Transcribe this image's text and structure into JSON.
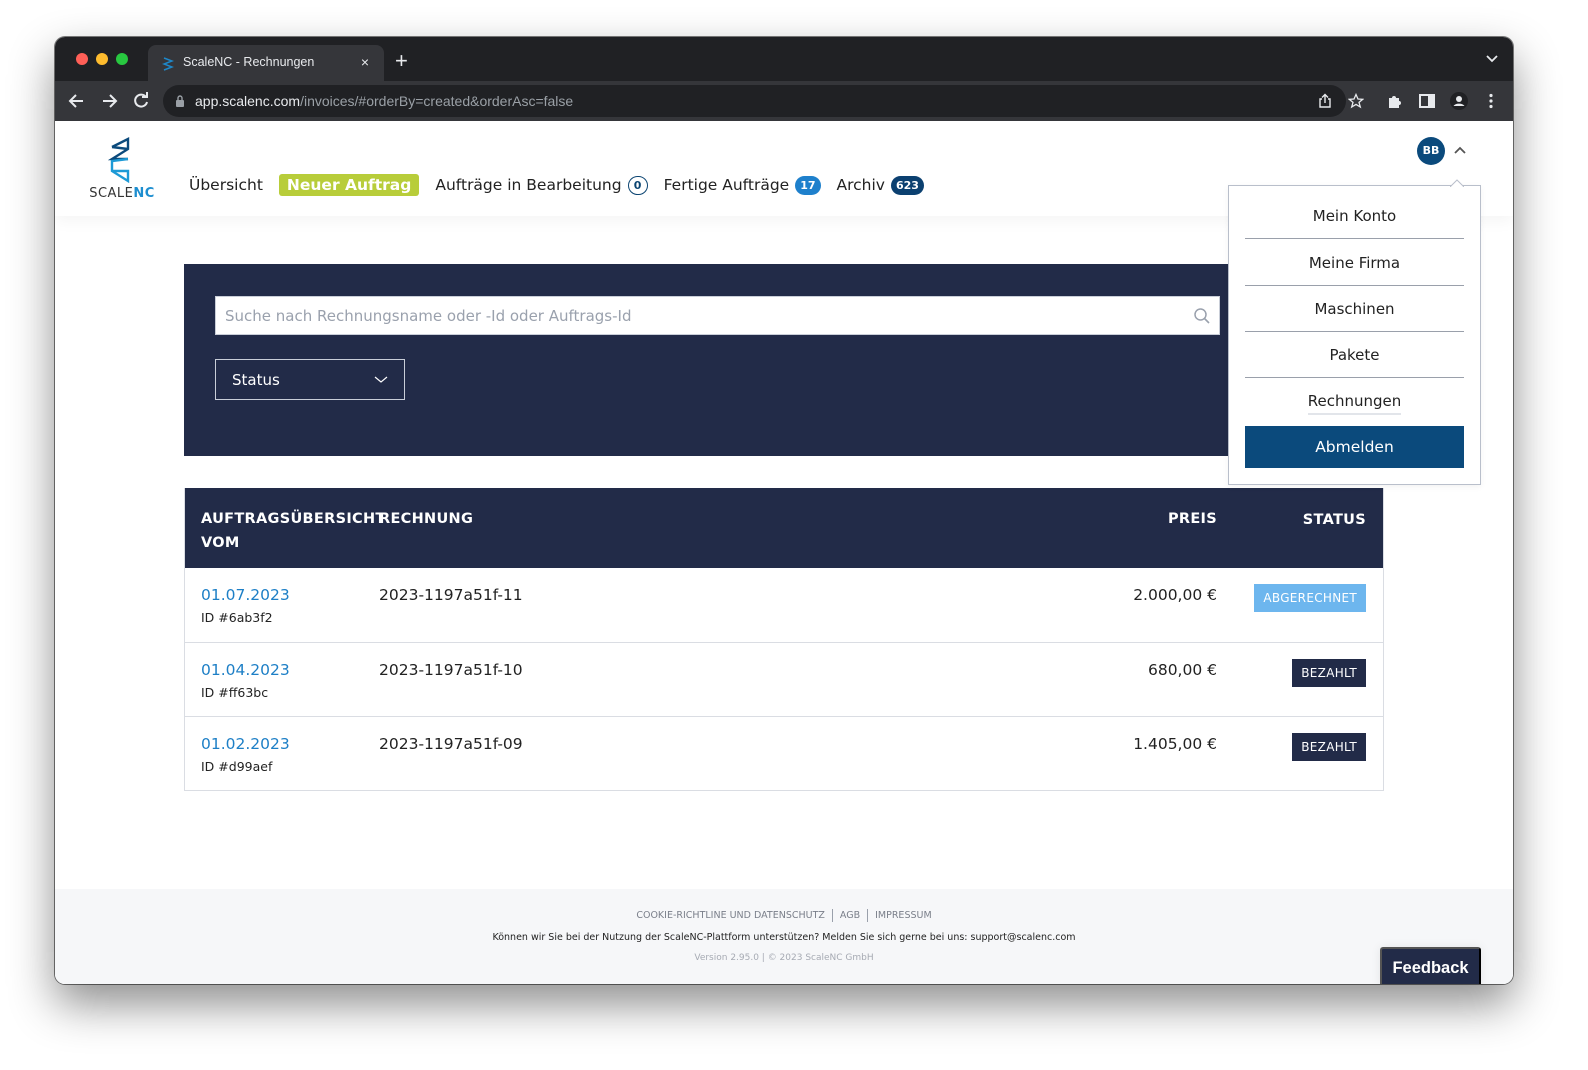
{
  "browser": {
    "tab_title": "ScaleNC - Rechnungen",
    "tab_close": "×",
    "new_tab": "+",
    "url_host": "app.scalenc.com",
    "url_path": "/invoices/#orderBy=created&orderAsc=false"
  },
  "header": {
    "logo_text_scale": "SCALE",
    "logo_text_nc": "NC",
    "nav": [
      {
        "label": "Übersicht"
      },
      {
        "label": "Neuer Auftrag"
      },
      {
        "label": "Aufträge in Bearbeitung",
        "badge": "0"
      },
      {
        "label": "Fertige Aufträge",
        "badge": "17"
      },
      {
        "label": "Archiv",
        "badge": "623"
      }
    ],
    "avatar_initials": "BB"
  },
  "user_menu": {
    "items": [
      {
        "label": "Mein Konto"
      },
      {
        "label": "Meine Firma"
      },
      {
        "label": "Maschinen"
      },
      {
        "label": "Pakete"
      },
      {
        "label": "Rechnungen"
      }
    ],
    "logout_label": "Abmelden"
  },
  "filters": {
    "search_placeholder": "Suche nach Rechnungsname oder -Id oder Auftrags-Id",
    "search_value": "",
    "status_label": "Status"
  },
  "table": {
    "columns": {
      "date": "AUFTRAGSÜBERSICHT VOM",
      "invoice": "RECHNUNG",
      "price": "PREIS",
      "status": "STATUS"
    },
    "rows": [
      {
        "date": "01.07.2023",
        "order_id": "ID #6ab3f2",
        "invoice": "2023-1197a51f-11",
        "price": "2.000,00 €",
        "status": "ABGERECHNET"
      },
      {
        "date": "01.04.2023",
        "order_id": "ID #ff63bc",
        "invoice": "2023-1197a51f-10",
        "price": "680,00 €",
        "status": "BEZAHLT"
      },
      {
        "date": "01.02.2023",
        "order_id": "ID #d99aef",
        "invoice": "2023-1197a51f-09",
        "price": "1.405,00 €",
        "status": "BEZAHLT"
      }
    ]
  },
  "footer": {
    "links": [
      "COOKIE-RICHTLINE UND DATENSCHUTZ",
      "AGB",
      "IMPRESSUM"
    ],
    "support_text": "Können wir Sie bei der Nutzung der ScaleNC-Plattform unterstützen? Melden Sie sich gerne bei uns: support@scalenc.com",
    "version_text": "Version 2.95.0 | © 2023 ScaleNC GmbH"
  },
  "feedback_label": "Feedback",
  "colors": {
    "navy": "#222b48",
    "brand_blue": "#0b4a7c",
    "link_blue": "#1d7fc6",
    "new_order_green": "#b8cd3a",
    "status_abgerechnet": "#6db6ee",
    "status_bezahlt": "#222b48"
  }
}
